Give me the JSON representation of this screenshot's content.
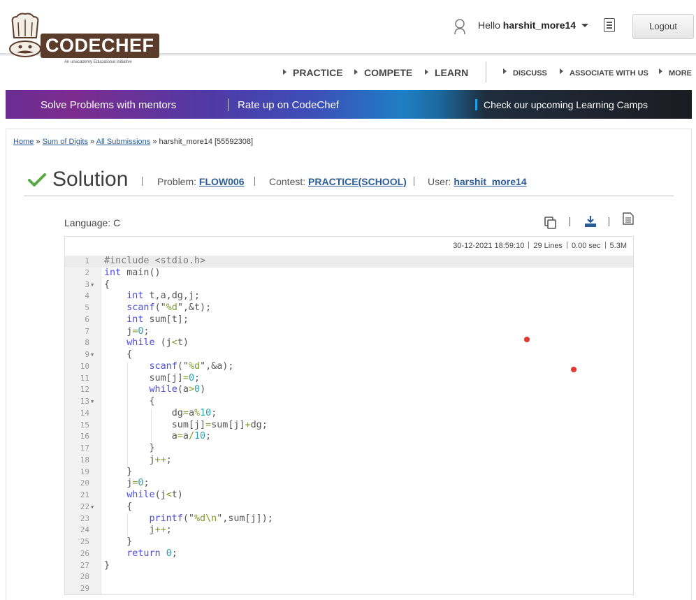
{
  "header": {
    "logo_text": "CODECHEF",
    "logo_tagline": "An unacademy Educational Initiative",
    "greeting": "Hello",
    "username": "harshit_more14",
    "logout_label": "Logout"
  },
  "nav": {
    "primary": [
      "PRACTICE",
      "COMPETE",
      "LEARN"
    ],
    "secondary": [
      "DISCUSS",
      "ASSOCIATE WITH US",
      "MORE"
    ]
  },
  "banner": {
    "left": "Solve Problems with mentors",
    "middle": "Rate up on CodeChef",
    "right": "Check our upcoming Learning Camps"
  },
  "breadcrumb": {
    "home": "Home",
    "problem": "Sum of Digits",
    "submissions": "All Submissions",
    "current": "harshit_more14 [55592308]"
  },
  "solution": {
    "title": "Solution",
    "problem_label": "Problem:",
    "problem_code": "FLOW006",
    "contest_label": "Contest:",
    "contest": "PRACTICE(SCHOOL)",
    "user_label": "User:",
    "user": "harshit_more14",
    "language": "Language: C"
  },
  "code_stats": {
    "datetime": "30-12-2021 18:59:10",
    "lines": "29 Lines",
    "time": "0.00 sec",
    "memory": "5.3M"
  },
  "code_lines": [
    "#include <stdio.h>",
    "int main()",
    "{",
    "    int t,a,dg,j;",
    "    scanf(\"%d\",&t);",
    "    int sum[t];",
    "    j=0;",
    "    while (j<t)",
    "    {",
    "        scanf(\"%d\",&a);",
    "        sum[j]=0;",
    "        while(a>0)",
    "        {",
    "            dg=a%10;",
    "            sum[j]=sum[j]+dg;",
    "            a=a/10;",
    "        }",
    "        j++;",
    "    }",
    "    j=0;",
    "    while(j<t)",
    "    {",
    "        printf(\"%d\\n\",sum[j]);",
    "        j++;",
    "    }",
    "    return 0;",
    "}",
    "",
    ""
  ],
  "fold_lines": [
    3,
    9,
    13,
    22
  ],
  "colors": {
    "accent_link": "#2a5d98",
    "check_green": "#5aa845",
    "keyword_blue": "#4a4ae6",
    "string_green": "#7c9c2c",
    "number_teal": "#2aa1b3",
    "marker_red": "#e03a2e"
  },
  "icons": [
    "user-icon",
    "caret-down-icon",
    "notes-icon",
    "check-icon",
    "copy-icon",
    "download-icon",
    "document-icon"
  ]
}
